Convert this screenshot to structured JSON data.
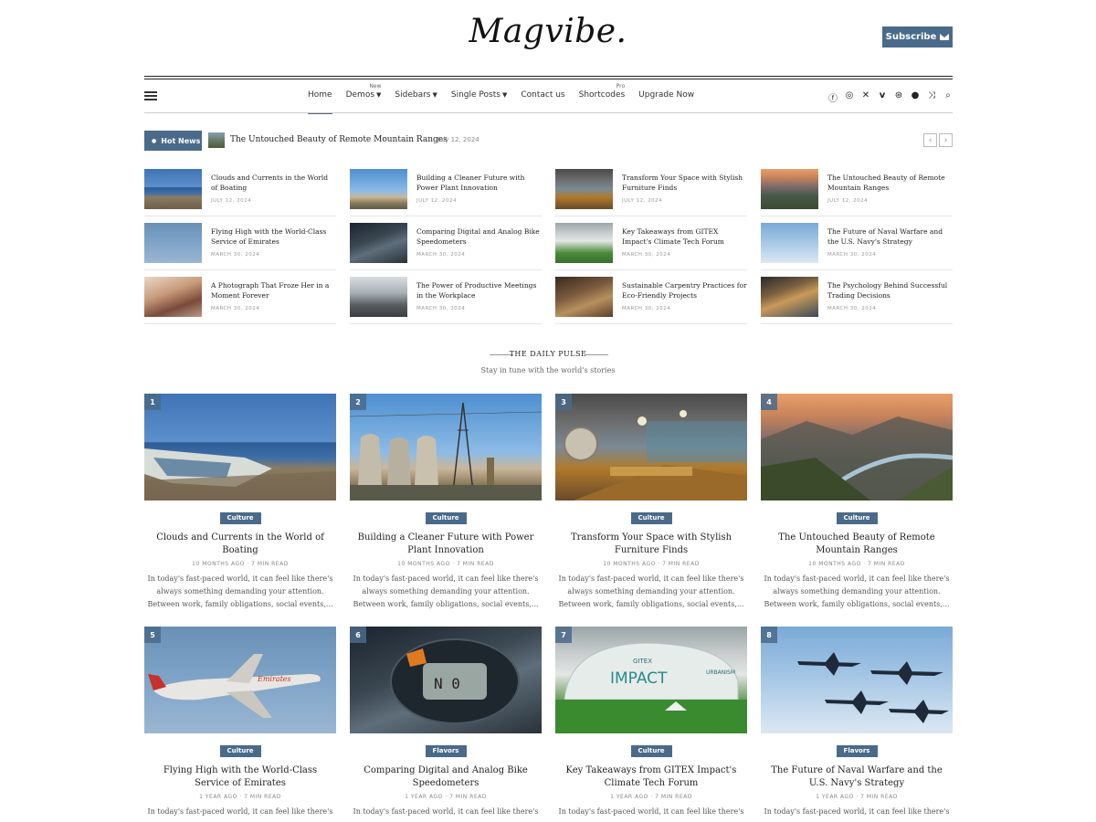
{
  "site": {
    "logo": "Magvibe.",
    "subscribe_label": "Subscribe"
  },
  "nav": {
    "items": [
      {
        "label": "Home",
        "badge": "",
        "active": true
      },
      {
        "label": "Demos",
        "badge": "New"
      },
      {
        "label": "Sidebars",
        "badge": ""
      },
      {
        "label": "Single Posts",
        "badge": ""
      },
      {
        "label": "Contact us",
        "badge": ""
      },
      {
        "label": "Shortcodes",
        "badge": "Pro"
      },
      {
        "label": "Upgrade Now",
        "badge": ""
      }
    ],
    "social_icons": [
      "facebook-icon",
      "instagram-icon",
      "x-icon",
      "vimeo-icon",
      "dribbble-icon",
      "github-icon",
      "shuffle-icon",
      "search-icon"
    ]
  },
  "hot_news": {
    "badge": "Hot News",
    "title": "The Untouched Beauty of Remote Mountain Ranges",
    "date": "July 12, 2024"
  },
  "small_posts": [
    {
      "title": "Clouds and Currents in the World of Boating",
      "date": "JULY 12, 2024"
    },
    {
      "title": "Building a Cleaner Future with Power Plant Innovation",
      "date": "JULY 12, 2024"
    },
    {
      "title": "Transform Your Space with Stylish Furniture Finds",
      "date": "JULY 12, 2024"
    },
    {
      "title": "The Untouched Beauty of Remote Mountain Ranges",
      "date": "JULY 12, 2024"
    },
    {
      "title": "Flying High with the World-Class Service of Emirates",
      "date": "MARCH 30, 2024"
    },
    {
      "title": "Comparing Digital and Analog Bike Speedometers",
      "date": "MARCH 30, 2024"
    },
    {
      "title": "Key Takeaways from GITEX Impact's Climate Tech Forum",
      "date": "MARCH 30, 2024"
    },
    {
      "title": "The Future of Naval Warfare and the U.S. Navy's Strategy",
      "date": "MARCH 30, 2024"
    },
    {
      "title": "A Photograph That Froze Her in a Moment Forever",
      "date": "MARCH 30, 2024"
    },
    {
      "title": "The Power of Productive Meetings in the Workplace",
      "date": "MARCH 30, 2024"
    },
    {
      "title": "Sustainable Carpentry Practices for Eco-Friendly Projects",
      "date": "MARCH 30, 2024"
    },
    {
      "title": "The Psychology Behind Successful Trading Decisions",
      "date": "MARCH 30, 2024"
    }
  ],
  "section": {
    "title": "THE DAILY PULSE",
    "subtitle": "Stay in tune with the world's stories"
  },
  "big_posts": [
    {
      "num": "1",
      "category": "Culture",
      "title": "Clouds and Currents in the World of Boating",
      "meta": "10 MONTHS AGO · 7 MIN READ",
      "excerpt": "In today's fast-paced world, it can feel like there's always something demanding your attention. Between work, family obligations, social events,..."
    },
    {
      "num": "2",
      "category": "Culture",
      "title": "Building a Cleaner Future with Power Plant Innovation",
      "meta": "10 MONTHS AGO · 7 MIN READ",
      "excerpt": "In today's fast-paced world, it can feel like there's always something demanding your attention. Between work, family obligations, social events,..."
    },
    {
      "num": "3",
      "category": "Culture",
      "title": "Transform Your Space with Stylish Furniture Finds",
      "meta": "10 MONTHS AGO · 7 MIN READ",
      "excerpt": "In today's fast-paced world, it can feel like there's always something demanding your attention. Between work, family obligations, social events,..."
    },
    {
      "num": "4",
      "category": "Culture",
      "title": "The Untouched Beauty of Remote Mountain Ranges",
      "meta": "10 MONTHS AGO · 7 MIN READ",
      "excerpt": "In today's fast-paced world, it can feel like there's always something demanding your attention. Between work, family obligations, social events,..."
    },
    {
      "num": "5",
      "category": "Culture",
      "title": "Flying High with the World-Class Service of Emirates",
      "meta": "1 YEAR AGO · 7 MIN READ",
      "excerpt": "In today's fast-paced world, it can feel like there's"
    },
    {
      "num": "6",
      "category": "Flavors",
      "title": "Comparing Digital and Analog Bike Speedometers",
      "meta": "1 YEAR AGO · 7 MIN READ",
      "excerpt": "In today's fast-paced world, it can feel like there's"
    },
    {
      "num": "7",
      "category": "Culture",
      "title": "Key Takeaways from GITEX Impact's Climate Tech Forum",
      "meta": "1 YEAR AGO · 7 MIN READ",
      "excerpt": "In today's fast-paced world, it can feel like there's"
    },
    {
      "num": "8",
      "category": "Flavors",
      "title": "The Future of Naval Warfare and the U.S. Navy's Strategy",
      "meta": "1 YEAR AGO · 7 MIN READ",
      "excerpt": "In today's fast-paced world, it can feel like there's"
    }
  ],
  "image_texts": {
    "gitex_1": "GITEX",
    "gitex_2": "IMPACT",
    "gitex_3": "URBANISM",
    "plane_livery": "Emirates",
    "speedo": "N 0"
  },
  "colors": {
    "accent": "#4a6a8a"
  }
}
